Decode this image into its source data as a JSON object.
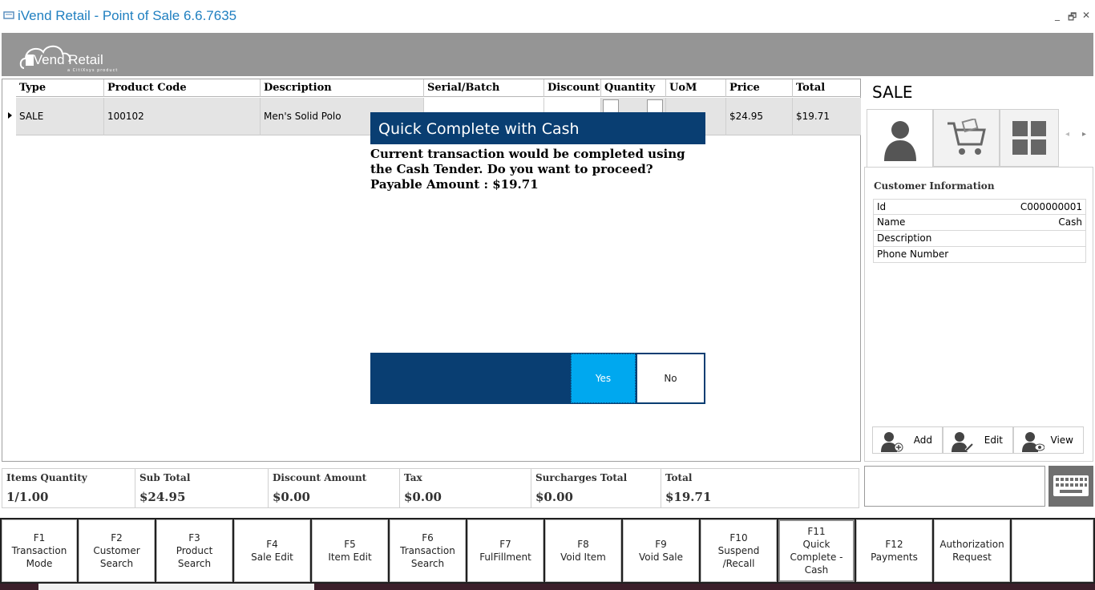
{
  "window": {
    "title": "iVend Retail - Point of Sale 6.6.7635",
    "minimize": "_",
    "restore": "🗗",
    "close": "✕"
  },
  "brand": {
    "logo_text": "iVend Retail",
    "logo_sub": "a CitiXsys product"
  },
  "grid": {
    "columns": [
      "Type",
      "Product Code",
      "Description",
      "Serial/Batch",
      "Discount",
      "Quantity",
      "UoM",
      "Price",
      "Total"
    ],
    "rows": [
      {
        "type": "SALE",
        "product_code": "100102",
        "description": "Men's Solid Polo",
        "serial": "",
        "discount": "",
        "quantity": "",
        "uom": "",
        "price": "$24.95",
        "total": "$19.71"
      }
    ]
  },
  "dialog": {
    "title": "Quick Complete with Cash",
    "message": "Current transaction would be completed using the Cash Tender. Do you want to proceed? Payable Amount : $19.71",
    "yes_label": "Yes",
    "no_label": "No"
  },
  "side": {
    "mode_label": "SALE",
    "tabs": [
      {
        "icon": "customer-icon"
      },
      {
        "icon": "cart-icon"
      },
      {
        "icon": "grid-icon"
      }
    ],
    "customer": {
      "title": "Customer Information",
      "fields": [
        {
          "key": "Id",
          "value": "C000000001"
        },
        {
          "key": "Name",
          "value": "Cash"
        },
        {
          "key": "Description",
          "value": ""
        },
        {
          "key": "Phone Number",
          "value": ""
        }
      ]
    },
    "actions": {
      "add": "Add",
      "edit": "Edit",
      "view": "View"
    }
  },
  "totals": [
    {
      "label": "Items Quantity",
      "value": "1/1.00"
    },
    {
      "label": "Sub Total",
      "value": "$24.95"
    },
    {
      "label": "Discount Amount",
      "value": "$0.00"
    },
    {
      "label": "Tax",
      "value": "$0.00"
    },
    {
      "label": "Surcharges Total",
      "value": "$0.00"
    },
    {
      "label": "Total",
      "value": "$19.71"
    }
  ],
  "scan_input": {
    "value": "",
    "placeholder": ""
  },
  "function_keys": [
    {
      "label": "F1\nTransaction\nMode"
    },
    {
      "label": "F2\nCustomer\nSearch"
    },
    {
      "label": "F3\nProduct\nSearch"
    },
    {
      "label": "F4\nSale Edit"
    },
    {
      "label": "F5\nItem Edit"
    },
    {
      "label": "F6\nTransaction\nSearch"
    },
    {
      "label": "F7\nFulFillment"
    },
    {
      "label": "F8\nVoid Item"
    },
    {
      "label": "F9\nVoid Sale"
    },
    {
      "label": "F10\nSuspend\n/Recall"
    },
    {
      "label": "F11\nQuick\nComplete -\nCash"
    },
    {
      "label": "F12\nPayments"
    },
    {
      "label": "Authorization\nRequest"
    },
    {
      "label": ""
    }
  ],
  "colors": {
    "accent": "#093e72",
    "yes_button": "#00a8ef",
    "title_text": "#1f7fc0",
    "banner": "#959595"
  }
}
